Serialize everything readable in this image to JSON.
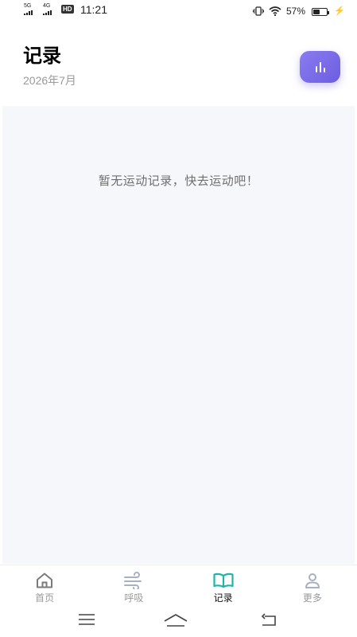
{
  "status_bar": {
    "sim1": "5G",
    "sim2": "4G",
    "hd": "HD",
    "time": "11:21",
    "battery_percent": "57%",
    "battery_level": 0.57
  },
  "header": {
    "title": "记录",
    "month": "2026年7月",
    "stats_icon": "bar-chart-icon"
  },
  "main": {
    "empty_message": "暂无运动记录，快去运动吧！"
  },
  "tab_bar": {
    "active_color": "#1fb5a8",
    "items": [
      {
        "label": "首页",
        "icon": "home-icon",
        "active": false
      },
      {
        "label": "呼吸",
        "icon": "wind-icon",
        "active": false
      },
      {
        "label": "记录",
        "icon": "book-icon",
        "active": true
      },
      {
        "label": "更多",
        "icon": "person-icon",
        "active": false
      }
    ]
  },
  "system_nav": {
    "icons": [
      "menu-icon",
      "home-nav-icon",
      "back-icon"
    ]
  },
  "colors": {
    "accent": "#7463e6",
    "panel_bg": "#f6f7fb"
  }
}
